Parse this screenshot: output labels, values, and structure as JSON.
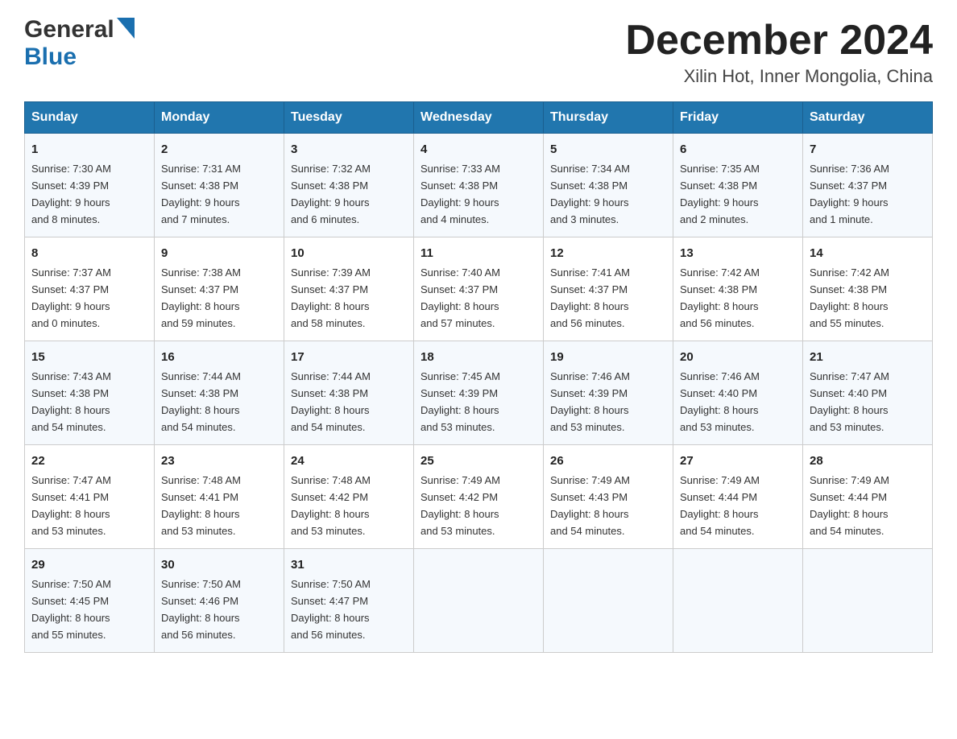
{
  "header": {
    "logo_general": "General",
    "logo_blue": "Blue",
    "title": "December 2024",
    "subtitle": "Xilin Hot, Inner Mongolia, China"
  },
  "weekdays": [
    "Sunday",
    "Monday",
    "Tuesday",
    "Wednesday",
    "Thursday",
    "Friday",
    "Saturday"
  ],
  "weeks": [
    [
      {
        "day": "1",
        "sunrise": "7:30 AM",
        "sunset": "4:39 PM",
        "daylight": "9 hours and 8 minutes."
      },
      {
        "day": "2",
        "sunrise": "7:31 AM",
        "sunset": "4:38 PM",
        "daylight": "9 hours and 7 minutes."
      },
      {
        "day": "3",
        "sunrise": "7:32 AM",
        "sunset": "4:38 PM",
        "daylight": "9 hours and 6 minutes."
      },
      {
        "day": "4",
        "sunrise": "7:33 AM",
        "sunset": "4:38 PM",
        "daylight": "9 hours and 4 minutes."
      },
      {
        "day": "5",
        "sunrise": "7:34 AM",
        "sunset": "4:38 PM",
        "daylight": "9 hours and 3 minutes."
      },
      {
        "day": "6",
        "sunrise": "7:35 AM",
        "sunset": "4:38 PM",
        "daylight": "9 hours and 2 minutes."
      },
      {
        "day": "7",
        "sunrise": "7:36 AM",
        "sunset": "4:37 PM",
        "daylight": "9 hours and 1 minute."
      }
    ],
    [
      {
        "day": "8",
        "sunrise": "7:37 AM",
        "sunset": "4:37 PM",
        "daylight": "9 hours and 0 minutes."
      },
      {
        "day": "9",
        "sunrise": "7:38 AM",
        "sunset": "4:37 PM",
        "daylight": "8 hours and 59 minutes."
      },
      {
        "day": "10",
        "sunrise": "7:39 AM",
        "sunset": "4:37 PM",
        "daylight": "8 hours and 58 minutes."
      },
      {
        "day": "11",
        "sunrise": "7:40 AM",
        "sunset": "4:37 PM",
        "daylight": "8 hours and 57 minutes."
      },
      {
        "day": "12",
        "sunrise": "7:41 AM",
        "sunset": "4:37 PM",
        "daylight": "8 hours and 56 minutes."
      },
      {
        "day": "13",
        "sunrise": "7:42 AM",
        "sunset": "4:38 PM",
        "daylight": "8 hours and 56 minutes."
      },
      {
        "day": "14",
        "sunrise": "7:42 AM",
        "sunset": "4:38 PM",
        "daylight": "8 hours and 55 minutes."
      }
    ],
    [
      {
        "day": "15",
        "sunrise": "7:43 AM",
        "sunset": "4:38 PM",
        "daylight": "8 hours and 54 minutes."
      },
      {
        "day": "16",
        "sunrise": "7:44 AM",
        "sunset": "4:38 PM",
        "daylight": "8 hours and 54 minutes."
      },
      {
        "day": "17",
        "sunrise": "7:44 AM",
        "sunset": "4:38 PM",
        "daylight": "8 hours and 54 minutes."
      },
      {
        "day": "18",
        "sunrise": "7:45 AM",
        "sunset": "4:39 PM",
        "daylight": "8 hours and 53 minutes."
      },
      {
        "day": "19",
        "sunrise": "7:46 AM",
        "sunset": "4:39 PM",
        "daylight": "8 hours and 53 minutes."
      },
      {
        "day": "20",
        "sunrise": "7:46 AM",
        "sunset": "4:40 PM",
        "daylight": "8 hours and 53 minutes."
      },
      {
        "day": "21",
        "sunrise": "7:47 AM",
        "sunset": "4:40 PM",
        "daylight": "8 hours and 53 minutes."
      }
    ],
    [
      {
        "day": "22",
        "sunrise": "7:47 AM",
        "sunset": "4:41 PM",
        "daylight": "8 hours and 53 minutes."
      },
      {
        "day": "23",
        "sunrise": "7:48 AM",
        "sunset": "4:41 PM",
        "daylight": "8 hours and 53 minutes."
      },
      {
        "day": "24",
        "sunrise": "7:48 AM",
        "sunset": "4:42 PM",
        "daylight": "8 hours and 53 minutes."
      },
      {
        "day": "25",
        "sunrise": "7:49 AM",
        "sunset": "4:42 PM",
        "daylight": "8 hours and 53 minutes."
      },
      {
        "day": "26",
        "sunrise": "7:49 AM",
        "sunset": "4:43 PM",
        "daylight": "8 hours and 54 minutes."
      },
      {
        "day": "27",
        "sunrise": "7:49 AM",
        "sunset": "4:44 PM",
        "daylight": "8 hours and 54 minutes."
      },
      {
        "day": "28",
        "sunrise": "7:49 AM",
        "sunset": "4:44 PM",
        "daylight": "8 hours and 54 minutes."
      }
    ],
    [
      {
        "day": "29",
        "sunrise": "7:50 AM",
        "sunset": "4:45 PM",
        "daylight": "8 hours and 55 minutes."
      },
      {
        "day": "30",
        "sunrise": "7:50 AM",
        "sunset": "4:46 PM",
        "daylight": "8 hours and 56 minutes."
      },
      {
        "day": "31",
        "sunrise": "7:50 AM",
        "sunset": "4:47 PM",
        "daylight": "8 hours and 56 minutes."
      },
      null,
      null,
      null,
      null
    ]
  ],
  "labels": {
    "sunrise": "Sunrise:",
    "sunset": "Sunset:",
    "daylight": "Daylight:"
  }
}
